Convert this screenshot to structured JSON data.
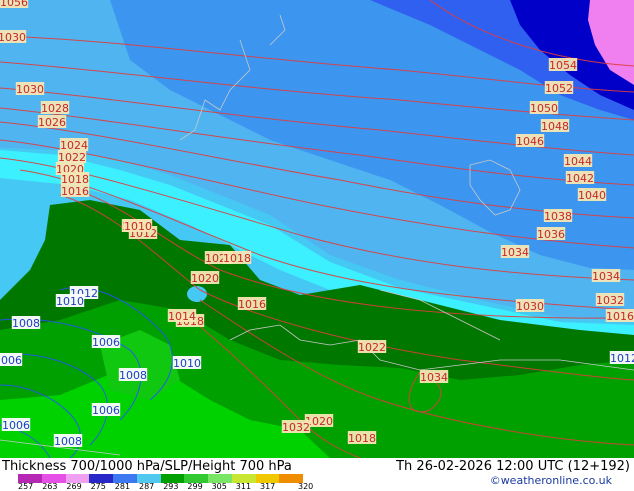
{
  "map": {
    "isobar_labels": [
      "1056",
      "1054",
      "1052",
      "1050",
      "1048",
      "1046",
      "1044",
      "1042",
      "1040",
      "1038",
      "1036",
      "1034",
      "1034",
      "1032",
      "1030",
      "1030",
      "1030",
      "1028",
      "1026",
      "1024",
      "1022",
      "1020",
      "1020",
      "1020",
      "1018",
      "1018",
      "1018",
      "1016",
      "1016",
      "1016",
      "1014",
      "1014",
      "1012",
      "1012",
      "1012",
      "1010",
      "1010",
      "1010",
      "1008",
      "1008",
      "1008",
      "1006",
      "1006",
      "1006",
      "1006",
      "1018",
      "1020",
      "1022",
      "1034",
      "1032"
    ],
    "colors": {
      "cold_pink": "#f080f0",
      "deep_blue": "#0000c8",
      "blue": "#2850f0",
      "mid_blue": "#3c8cf0",
      "light_blue": "#46b4f0",
      "sky_blue": "#46c8f5",
      "cyan": "#3cf0ff",
      "dark_green": "#007800",
      "green": "#00a000",
      "bright_green": "#00d200",
      "isobar": "#e03c3c",
      "isobar_blue": "#2850ff"
    }
  },
  "footer": {
    "title": "Thickness 700/1000 hPa/SLP/Height 700 hPa",
    "datetime": "Th 26-02-2026 12:00 UTC (12+192)",
    "credit": "©weatheronline.co.uk",
    "scale_labels": [
      "257",
      "263",
      "269",
      "275",
      "281",
      "287",
      "293",
      "299",
      "305",
      "311",
      "317",
      "320"
    ],
    "scale_colors": [
      "#b428b4",
      "#e650e6",
      "#f0a0f0",
      "#2828c8",
      "#3c78f0",
      "#50c8f0",
      "#00a000",
      "#32c832",
      "#78e664",
      "#c8e632",
      "#f0c800",
      "#f08c00"
    ]
  }
}
